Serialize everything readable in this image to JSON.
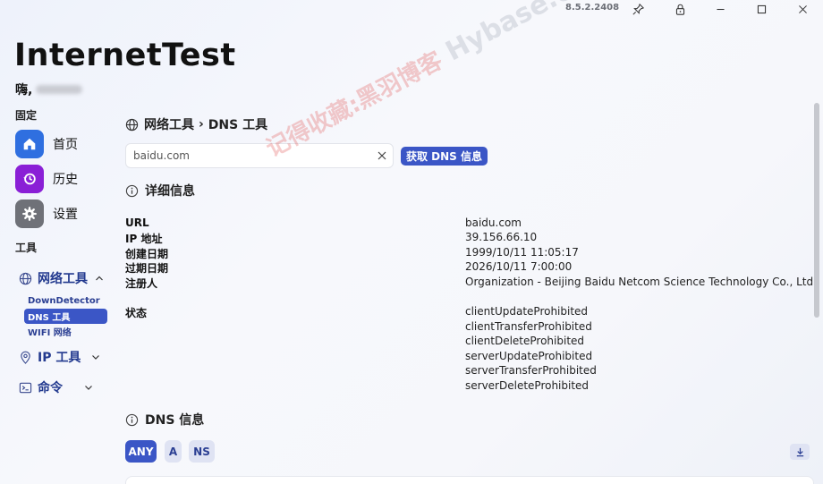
{
  "window": {
    "version": "8.5.2.2408"
  },
  "app": {
    "title": "InternetTest",
    "greeting_prefix": "嗨,"
  },
  "sidebar": {
    "pinned_label": "固定",
    "pinned_items": [
      {
        "label": "首页",
        "icon": "home-icon",
        "color": "#2f6fe0"
      },
      {
        "label": "历史",
        "icon": "history-icon",
        "color": "#8a1fd6"
      },
      {
        "label": "设置",
        "icon": "gear-icon",
        "color": "#6f7178"
      }
    ],
    "tools_label": "工具",
    "groups": [
      {
        "label": "网络工具",
        "icon": "globe-icon",
        "expanded": true,
        "children": [
          "DownDetector",
          "DNS 工具",
          "WIFI 网络"
        ],
        "active_child": 1
      },
      {
        "label": "IP 工具",
        "icon": "location-pin-icon",
        "expanded": false
      },
      {
        "label": "命令",
        "icon": "command-icon",
        "expanded": false
      }
    ]
  },
  "main": {
    "breadcrumb": {
      "parent": "网络工具",
      "separator": "›",
      "current": "DNS 工具"
    },
    "search": {
      "value": "baidu.com",
      "placeholder": ""
    },
    "fetch_button": "获取 DNS 信息",
    "details": {
      "title": "详细信息",
      "rows": [
        {
          "label": "URL",
          "value": "baidu.com"
        },
        {
          "label": "IP 地址",
          "value": "39.156.66.10"
        },
        {
          "label": "创建日期",
          "value": "1999/10/11 11:05:17"
        },
        {
          "label": "过期日期",
          "value": "2026/10/11 7:00:00"
        },
        {
          "label": "注册人",
          "value": "Organization - Beijing Baidu Netcom Science Technology Co., Ltd."
        }
      ],
      "status_label": "状态",
      "status_values": [
        "clientUpdateProhibited",
        "clientTransferProhibited",
        "clientDeleteProhibited",
        "serverUpdateProhibited",
        "serverTransferProhibited",
        "serverDeleteProhibited"
      ]
    },
    "dns": {
      "title": "DNS 信息",
      "record_types": [
        "ANY",
        "A",
        "NS"
      ],
      "active_type": "ANY"
    }
  },
  "watermark": {
    "cn": "记得收藏:黑羽博客",
    "en": "Hybase.com"
  },
  "colors": {
    "accent": "#3b56c6",
    "accent_soft": "#dfe3f3"
  }
}
